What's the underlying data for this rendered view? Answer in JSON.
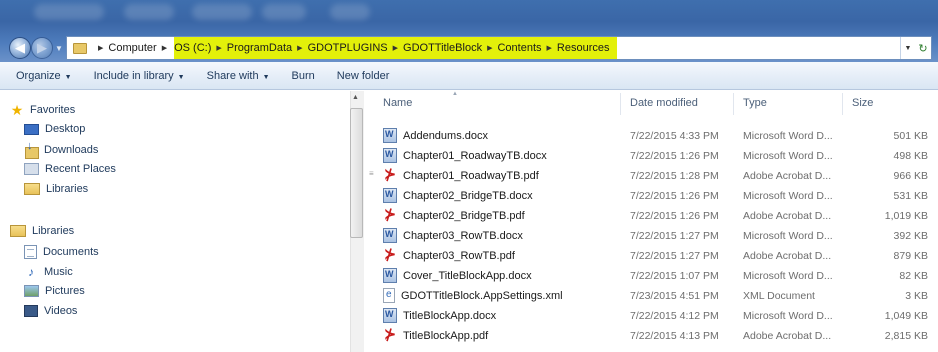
{
  "window": {
    "accent": "#3f6fae",
    "highlight_color": "#e3f00a"
  },
  "navigation": {
    "back_icon": "back-arrow-icon",
    "forward_icon": "forward-arrow-icon",
    "breadcrumb": [
      "Computer",
      "OS (C:)",
      "ProgramData",
      "GDOTPLUGINS",
      "GDOTTitleBlock",
      "Contents",
      "Resources"
    ]
  },
  "toolbar": {
    "organize": "Organize",
    "include_in_library": "Include in library",
    "share_with": "Share with",
    "burn": "Burn",
    "new_folder": "New folder"
  },
  "sidebar": {
    "favorites_label": "Favorites",
    "favorites": [
      {
        "label": "Desktop",
        "icon": "desktop-icon"
      },
      {
        "label": "Downloads",
        "icon": "downloads-icon"
      },
      {
        "label": "Recent Places",
        "icon": "recent-places-icon"
      },
      {
        "label": "Libraries",
        "icon": "libraries-icon"
      }
    ],
    "libraries_label": "Libraries",
    "libraries": [
      {
        "label": "Documents",
        "icon": "documents-icon"
      },
      {
        "label": "Music",
        "icon": "music-icon"
      },
      {
        "label": "Pictures",
        "icon": "pictures-icon"
      },
      {
        "label": "Videos",
        "icon": "videos-icon"
      }
    ]
  },
  "files": {
    "columns": {
      "name": "Name",
      "date": "Date modified",
      "type": "Type",
      "size": "Size"
    },
    "rows": [
      {
        "name": "Addendums.docx",
        "date": "7/22/2015 4:33 PM",
        "type": "Microsoft Word D...",
        "size": "501 KB",
        "kind": "word"
      },
      {
        "name": "Chapter01_RoadwayTB.docx",
        "date": "7/22/2015 1:26 PM",
        "type": "Microsoft Word D...",
        "size": "498 KB",
        "kind": "word"
      },
      {
        "name": "Chapter01_RoadwayTB.pdf",
        "date": "7/22/2015 1:28 PM",
        "type": "Adobe Acrobat D...",
        "size": "966 KB",
        "kind": "pdf"
      },
      {
        "name": "Chapter02_BridgeTB.docx",
        "date": "7/22/2015 1:26 PM",
        "type": "Microsoft Word D...",
        "size": "531 KB",
        "kind": "word"
      },
      {
        "name": "Chapter02_BridgeTB.pdf",
        "date": "7/22/2015 1:26 PM",
        "type": "Adobe Acrobat D...",
        "size": "1,019 KB",
        "kind": "pdf"
      },
      {
        "name": "Chapter03_RowTB.docx",
        "date": "7/22/2015 1:27 PM",
        "type": "Microsoft Word D...",
        "size": "392 KB",
        "kind": "word"
      },
      {
        "name": "Chapter03_RowTB.pdf",
        "date": "7/22/2015 1:27 PM",
        "type": "Adobe Acrobat D...",
        "size": "879 KB",
        "kind": "pdf"
      },
      {
        "name": "Cover_TitleBlockApp.docx",
        "date": "7/22/2015 1:07 PM",
        "type": "Microsoft Word D...",
        "size": "82 KB",
        "kind": "word"
      },
      {
        "name": "GDOTTitleBlock.AppSettings.xml",
        "date": "7/23/2015 4:51 PM",
        "type": "XML Document",
        "size": "3 KB",
        "kind": "xml"
      },
      {
        "name": "TitleBlockApp.docx",
        "date": "7/22/2015 4:12 PM",
        "type": "Microsoft Word D...",
        "size": "1,049 KB",
        "kind": "word"
      },
      {
        "name": "TitleBlockApp.pdf",
        "date": "7/22/2015 4:13 PM",
        "type": "Adobe Acrobat D...",
        "size": "2,815 KB",
        "kind": "pdf"
      }
    ]
  }
}
